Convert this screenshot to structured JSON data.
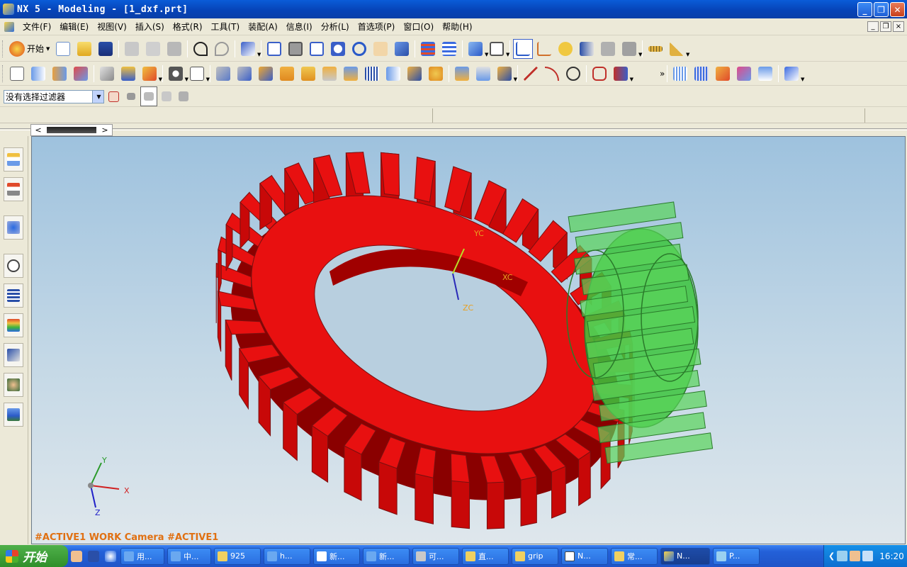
{
  "window": {
    "title": "NX 5 - Modeling - [1_dxf.prt]"
  },
  "menubar": {
    "items": [
      "文件(F)",
      "编辑(E)",
      "视图(V)",
      "插入(S)",
      "格式(R)",
      "工具(T)",
      "装配(A)",
      "信息(I)",
      "分析(L)",
      "首选项(P)",
      "窗口(O)",
      "帮助(H)"
    ]
  },
  "toolbar": {
    "start_label": "开始"
  },
  "selection": {
    "filter_value": "没有选择过滤器"
  },
  "viewport": {
    "status_text": "#ACTIVE1 WORK Camera #ACTIVE1",
    "wcs_labels": {
      "yc": "YC",
      "xc": "XC",
      "zc": "ZC"
    },
    "triad_labels": {
      "y": "Y",
      "x": "X",
      "z": "Z"
    },
    "colors": {
      "gear": "#e81010",
      "pinion": "#3cc43c",
      "status": "#e07012"
    }
  },
  "taskbar": {
    "start_label": "开始",
    "tasks": [
      "用...",
      "中...",
      "925",
      "h...",
      "新...",
      "新...",
      "可...",
      "直...",
      "grip",
      "N...",
      "常...",
      "N...",
      "P..."
    ],
    "clock": "16:20"
  }
}
